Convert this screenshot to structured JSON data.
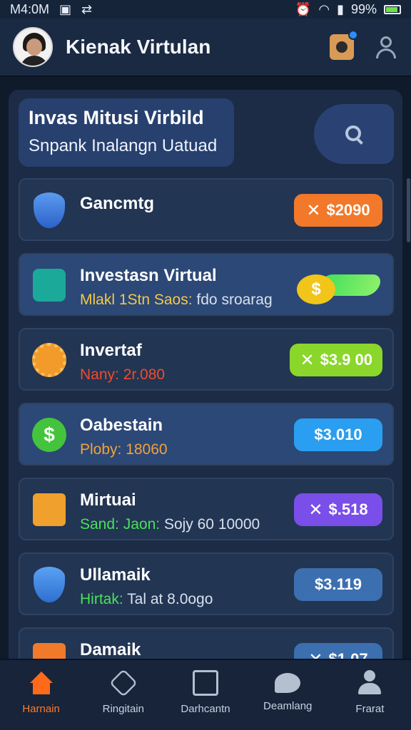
{
  "status_bar": {
    "time": "M4:0M",
    "battery": "99%"
  },
  "header": {
    "title": "Kienak Virtulan"
  },
  "promo": {
    "title": "Invas Mitusi Virbild",
    "subtitle": "Snpank Inalangn Uatuad"
  },
  "cards": [
    {
      "title": "Gancmtg",
      "sub_key": "",
      "sub_val": "",
      "amount": "$2090",
      "pill_color": "#f2782a",
      "pill_x": "✕",
      "icon": "shield-location-icon",
      "sub_color": ""
    },
    {
      "title": "Investasn Virtual",
      "sub_key": "Mlakl 1Stn Saos:",
      "sub_val": "fdo sroarag",
      "amount": "$",
      "icon": "money-exchange-icon",
      "sub_color": "#f2c948"
    },
    {
      "title": "Invertaf",
      "sub_key": "Nany: 2r.080",
      "sub_val": "",
      "amount": "$3.9 00",
      "pill_color": "#8ad62a",
      "pill_x": "✕",
      "icon": "gear-coin-icon",
      "sub_color": "#f24a2a"
    },
    {
      "title": "Oabestain",
      "sub_key": "Ploby: 18060",
      "sub_val": "",
      "amount": "$3.010",
      "pill_color": "#2a9ef0",
      "pill_x": "",
      "icon": "dollar-coin-icon",
      "sub_color": "#f2a23a"
    },
    {
      "title": "Mirtuai",
      "sub_key": "Sand: Jaon:",
      "sub_val": "Sojy 60 10000",
      "amount": "$.518",
      "pill_color": "#7a4ee8",
      "pill_x": "✕",
      "icon": "box-icon",
      "sub_color": "#4ae05a"
    },
    {
      "title": "Ullamaik",
      "sub_key": "Hirtak:",
      "sub_val": "Tal at 8.0ogo",
      "amount": "$3.119",
      "pill_color": "#3c6fb0",
      "pill_x": "",
      "icon": "shield-check-icon",
      "sub_color": "#4ae05a"
    },
    {
      "title": "Damaik",
      "sub_key": "",
      "sub_val": "",
      "amount": "$1.07",
      "pill_color": "#3c6fb0",
      "pill_x": "✕",
      "icon": "orange-square-icon",
      "sub_color": ""
    }
  ],
  "nav": [
    {
      "label": "Harnain",
      "icon": "home-icon"
    },
    {
      "label": "Ringitain",
      "icon": "location-icon"
    },
    {
      "label": "Darhcantn",
      "icon": "calendar-icon"
    },
    {
      "label": "Deamlang",
      "icon": "chat-icon"
    },
    {
      "label": "Frarat",
      "icon": "user-icon"
    }
  ]
}
